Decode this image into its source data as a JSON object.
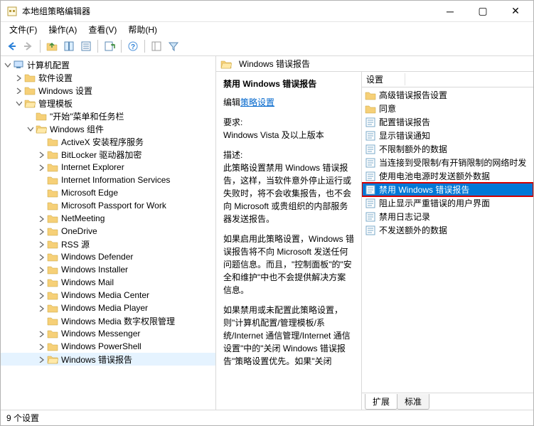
{
  "title": "本地组策略编辑器",
  "menu": {
    "file": "文件(F)",
    "action": "操作(A)",
    "view": "查看(V)",
    "help": "帮助(H)"
  },
  "tree": {
    "root": "计算机配置",
    "software": "软件设置",
    "windows_settings": "Windows 设置",
    "admin": "管理模板",
    "start_menu": "\"开始\"菜单和任务栏",
    "win_components": "Windows 组件",
    "items": {
      "activex": "ActiveX 安装程序服务",
      "bitlocker": "BitLocker 驱动器加密",
      "ie": "Internet Explorer",
      "iis": "Internet Information Services",
      "edge": "Microsoft Edge",
      "passport": "Microsoft Passport for Work",
      "netmeeting": "NetMeeting",
      "onedrive": "OneDrive",
      "rss": "RSS 源",
      "defender": "Windows Defender",
      "installer": "Windows Installer",
      "mail": "Windows Mail",
      "media_center": "Windows Media Center",
      "media_player": "Windows Media Player",
      "media_drm": "Windows Media 数字权限管理",
      "messenger": "Windows Messenger",
      "powershell": "Windows PowerShell",
      "error_report": "Windows 错误报告"
    }
  },
  "right": {
    "header": "Windows 错误报告",
    "policy_title": "禁用 Windows 错误报告",
    "edit_label": "编辑",
    "edit_link": "策略设置",
    "req_label": "要求:",
    "req": "Windows Vista 及以上版本",
    "desc_label": "描述:",
    "desc1": "此策略设置禁用 Windows 错误报告，这样，当软件意外停止运行或失败时，将不会收集报告，也不会向 Microsoft 或贵组织的内部服务器发送报告。",
    "desc2": "如果启用此策略设置，Windows 错误报告将不向 Microsoft 发送任何问题信息。而且，\"控制面板\"的\"安全和维护\"中也不会提供解决方案信息。",
    "desc3": "如果禁用或未配置此策略设置，则\"计算机配置/管理模板/系统/Internet 通信管理/Internet 通信设置\"中的\"关闭 Windows 错误报告\"策略设置优先。如果\"关闭",
    "col_header": "设置",
    "settings": [
      {
        "label": "高级错误报告设置",
        "type": "folder"
      },
      {
        "label": "同意",
        "type": "folder"
      },
      {
        "label": "配置错误报告",
        "type": "setting"
      },
      {
        "label": "显示错误通知",
        "type": "setting"
      },
      {
        "label": "不限制额外的数据",
        "type": "setting"
      },
      {
        "label": "当连接到受限制/有开销限制的网络时发",
        "type": "setting"
      },
      {
        "label": "使用电池电源时发送额外数据",
        "type": "setting"
      },
      {
        "label": "禁用 Windows 错误报告",
        "type": "setting",
        "highlighted": true
      },
      {
        "label": "阻止显示严重错误的用户界面",
        "type": "setting"
      },
      {
        "label": "禁用日志记录",
        "type": "setting"
      },
      {
        "label": "不发送额外的数据",
        "type": "setting"
      }
    ],
    "tabs": {
      "ext": "扩展",
      "std": "标准"
    }
  },
  "status": "9 个设置"
}
